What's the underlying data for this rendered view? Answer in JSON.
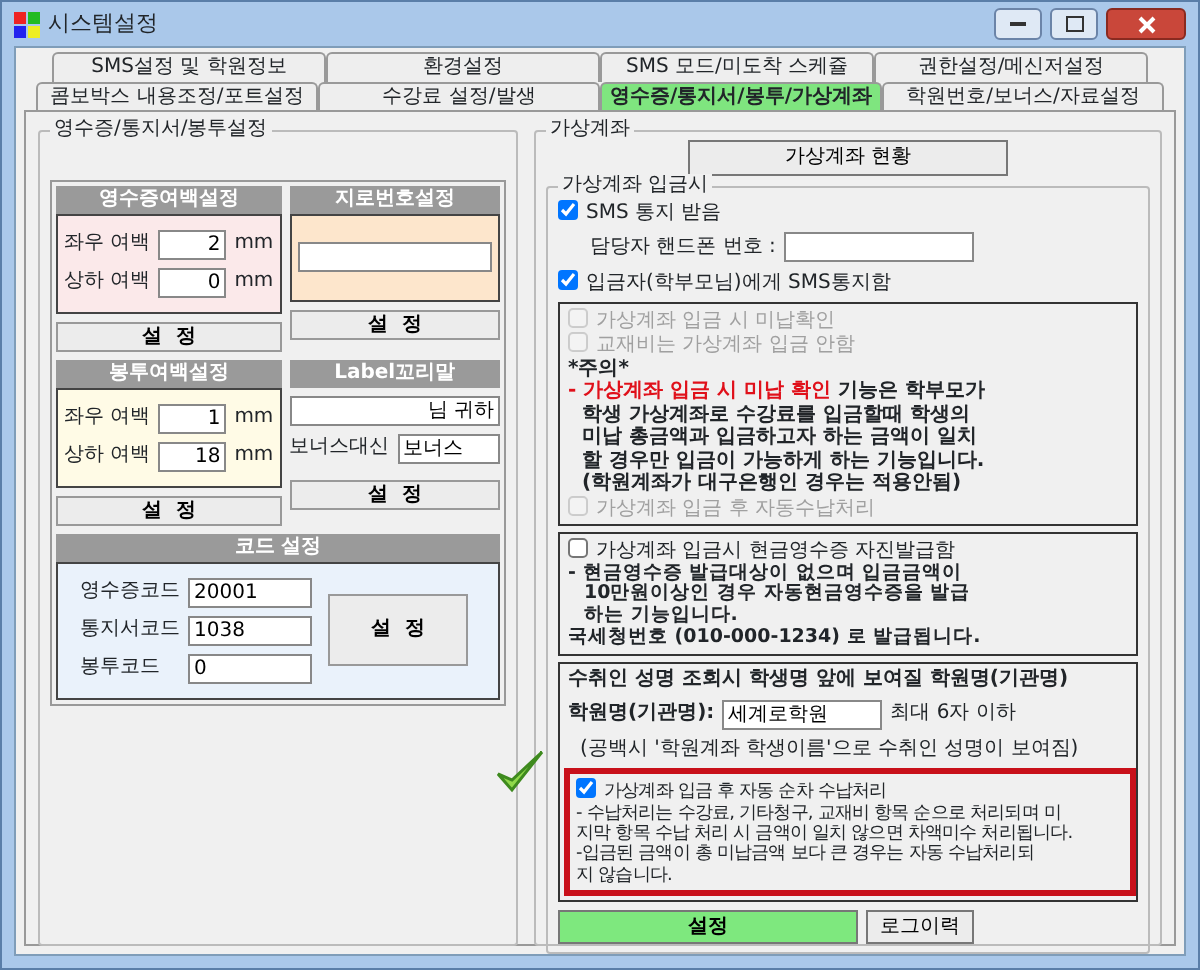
{
  "window": {
    "title": "시스템설정"
  },
  "tab_rows": [
    [
      {
        "label": "SMS설정 및 학원정보",
        "selected": false
      },
      {
        "label": "환경설정",
        "selected": false
      },
      {
        "label": "SMS 모드/미도착 스케쥴",
        "selected": false
      },
      {
        "label": "권한설정/메신저설정",
        "selected": false
      }
    ],
    [
      {
        "label": "콤보박스 내용조정/포트설정",
        "selected": false
      },
      {
        "label": "수강료 설정/발생",
        "selected": false
      },
      {
        "label": "영수증/통지서/봉투/가상계좌",
        "selected": true
      },
      {
        "label": "학원번호/보너스/자료설정",
        "selected": false
      }
    ]
  ],
  "left": {
    "title": "영수증/통지서/봉투설정",
    "receipt_margin": {
      "header": "영수증여백설정",
      "fields": [
        {
          "label": "좌우 여백",
          "value": "2",
          "unit": "mm"
        },
        {
          "label": "상하 여백",
          "value": "0",
          "unit": "mm"
        }
      ],
      "button": "설  정"
    },
    "giro": {
      "header": "지로번호설정",
      "button": "설  정"
    },
    "envelope_margin": {
      "header": "봉투여백설정",
      "fields": [
        {
          "label": "좌우 여백",
          "value": "1",
          "unit": "mm"
        },
        {
          "label": "상하 여백",
          "value": "18",
          "unit": "mm"
        }
      ],
      "button": "설  정"
    },
    "label_suffix": {
      "header": "Label꼬리말",
      "value": "님 귀하",
      "bonus_label": "보너스대신",
      "bonus_value": "보너스",
      "button": "설  정"
    },
    "codes": {
      "header": "코드 설정",
      "fields": [
        {
          "label": "영수증코드",
          "value": "20001"
        },
        {
          "label": "통지서코드",
          "value": "1038"
        },
        {
          "label": "봉투코드",
          "value": "0"
        }
      ],
      "button": "설  정"
    }
  },
  "right": {
    "title": "가상계좌",
    "status_button": "가상계좌 현황",
    "deposit": {
      "title": "가상계좌 입금시",
      "sms_notice": {
        "label": "SMS 통지 받음",
        "checked": true
      },
      "phone_label": "담당자 핸드폰 번호 :",
      "parent_sms": {
        "label": "입금자(학부모님)에게 SMS통지함",
        "checked": true
      },
      "unpaid_box": {
        "options": [
          {
            "label": "가상계좌 입금 시 미납확인",
            "checked": false,
            "disabled": true
          },
          {
            "label": "교재비는 가상계좌 입금 안함",
            "checked": false,
            "disabled": true
          }
        ],
        "caution": "*주의*",
        "lines": [
          {
            "highlight": "- 가상계좌 입금 시 미납 확인",
            "text": "기능은 학부모가"
          },
          {
            "text": "학생 가상계좌로 수강료를 입금할때  학생의"
          },
          {
            "text": "미납 총금액과 입금하고자 하는 금액이 일치"
          },
          {
            "text": "할 경우만 입금이 가능하게 하는 기능입니다."
          },
          {
            "text": "(학원계좌가 대구은행인 경우는 적용안됨)"
          }
        ],
        "auto_option": {
          "label": "가상계좌 입금 후  자동수납처리",
          "checked": false,
          "disabled": true
        }
      },
      "cash_receipt": {
        "option": {
          "label": "가상계좌 입금시 현금영수증 자진발급함",
          "checked": false
        },
        "lines": [
          "- 현금영수증 발급대상이 없으며  입금금액이",
          "10만원이상인 경우 자동현금영수증을 발급",
          "하는 기능입니다.",
          "국세청번호 (010-000-1234) 로 발급됩니다."
        ]
      },
      "payee_name": {
        "heading": "수취인 성명 조회시  학생명 앞에 보여질 학원명(기관명)",
        "field_label": "학원명(기관명):",
        "value": "세계로학원",
        "hint": "최대 6자 이하",
        "note": "(공백시 '학원계좌 학생이름'으로 수취인 성명이 보여짐)"
      },
      "auto_payment": {
        "option": {
          "label": "가상계좌 입금 후 자동 순차 수납처리",
          "checked": true
        },
        "lines": [
          "- 수납처리는 수강료, 기타청구, 교재비 항목 순으로 처리되며   미",
          "지막 항목 수납 처리 시 금액이 일치 않으면 차액미수 처리됩니다.",
          "-입금된 금액이 총 미납금액 보다 큰 경우는 자동 수납처리되",
          "지 않습니다."
        ]
      },
      "buttons": [
        {
          "label": "설정",
          "kind": "primary"
        },
        {
          "label": "로그이력",
          "kind": "plain"
        }
      ]
    }
  }
}
